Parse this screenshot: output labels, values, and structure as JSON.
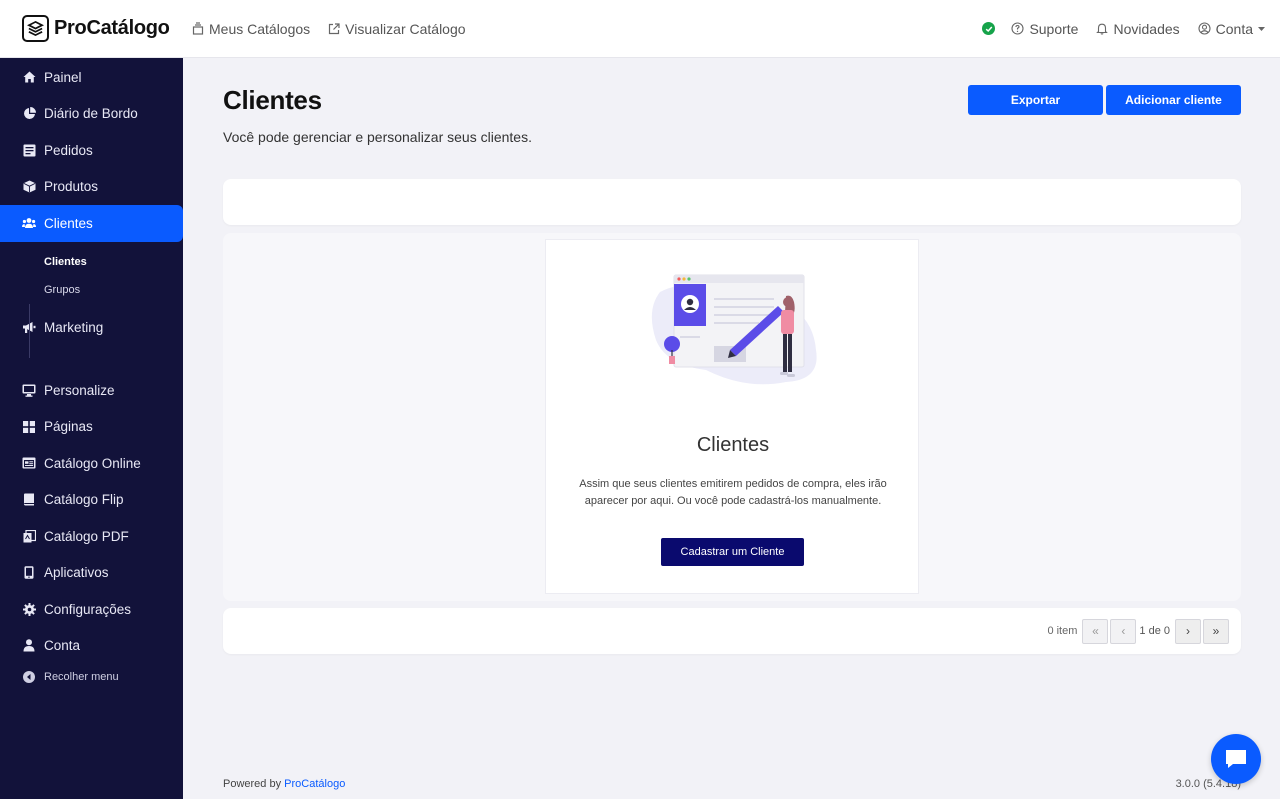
{
  "app": {
    "name": "ProCatálogo"
  },
  "topnav": {
    "items": [
      {
        "label": "Meus Catálogos",
        "icon": "stack-icon"
      },
      {
        "label": "Visualizar Catálogo",
        "icon": "external-link-icon"
      }
    ],
    "right": {
      "status_color": "#16a34a",
      "support_label": "Suporte",
      "news_label": "Novidades",
      "account_label": "Conta"
    }
  },
  "sidebar": {
    "items": [
      {
        "label": "Painel",
        "icon": "home-icon"
      },
      {
        "label": "Diário de Bordo",
        "icon": "pie-chart-icon"
      },
      {
        "label": "Pedidos",
        "icon": "list-icon"
      },
      {
        "label": "Produtos",
        "icon": "box-icon"
      },
      {
        "label": "Clientes",
        "icon": "users-icon",
        "active": true
      },
      {
        "label": "Marketing",
        "icon": "megaphone-icon"
      },
      {
        "label": "Personalize",
        "icon": "monitor-icon"
      },
      {
        "label": "Páginas",
        "icon": "grid-icon"
      },
      {
        "label": "Catálogo Online",
        "icon": "browser-icon"
      },
      {
        "label": "Catálogo Flip",
        "icon": "book-icon"
      },
      {
        "label": "Catálogo PDF",
        "icon": "pdf-icon"
      },
      {
        "label": "Aplicativos",
        "icon": "mobile-icon"
      },
      {
        "label": "Configurações",
        "icon": "gear-icon"
      },
      {
        "label": "Conta",
        "icon": "user-icon"
      }
    ],
    "subitems": [
      {
        "label": "Clientes",
        "active": true
      },
      {
        "label": "Grupos"
      }
    ],
    "collapse_label": "Recolher menu"
  },
  "page": {
    "title": "Clientes",
    "subtitle": "Você pode gerenciar e personalizar seus clientes.",
    "export_label": "Exportar",
    "add_label": "Adicionar cliente"
  },
  "empty_state": {
    "title": "Clientes",
    "text": "Assim que seus clientes emitirem pedidos de compra, eles irão aparecer por aqui. Ou você pode cadastrá-los manualmente.",
    "button_label": "Cadastrar um Cliente"
  },
  "pager": {
    "count": "0 item",
    "first": "«",
    "prev": "‹",
    "page": "1 de 0",
    "next": "›",
    "last": "»"
  },
  "footer": {
    "powered_prefix": "Powered by",
    "powered_link": "ProCatálogo",
    "version": "3.0.0 (5.4.18)"
  },
  "colors": {
    "accent": "#0a5bff",
    "sidebar_bg": "#12123a",
    "dark_button": "#0a0a6e"
  }
}
